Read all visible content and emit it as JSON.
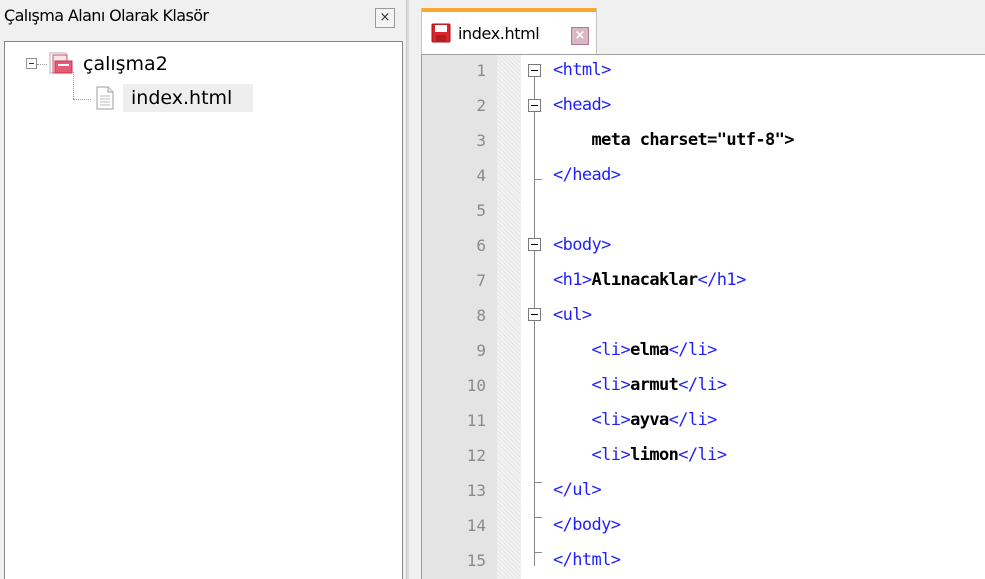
{
  "left_panel": {
    "title": "Çalışma Alanı Olarak Klasör",
    "close_glyph": "×"
  },
  "tree": {
    "root": {
      "label": "çalışma2",
      "icon": "folder-icon",
      "expanded": true
    },
    "children": [
      {
        "label": "index.html",
        "icon": "file-icon"
      }
    ]
  },
  "tabs": [
    {
      "label": "index.html",
      "icon": "save-icon",
      "active": true,
      "close_glyph": "×"
    }
  ],
  "editor": {
    "lines": [
      {
        "num": "1",
        "parts": [
          [
            "tag",
            "<html>"
          ]
        ]
      },
      {
        "num": "2",
        "parts": [
          [
            "tag",
            "<head>"
          ]
        ]
      },
      {
        "num": "3",
        "parts": [
          [
            "txt",
            "    meta charset=\"utf-8\">"
          ]
        ]
      },
      {
        "num": "4",
        "parts": [
          [
            "tag",
            "</head>"
          ]
        ]
      },
      {
        "num": "5",
        "parts": []
      },
      {
        "num": "6",
        "parts": [
          [
            "tag",
            "<body>"
          ]
        ]
      },
      {
        "num": "7",
        "parts": [
          [
            "tag",
            "<h1>"
          ],
          [
            "txt",
            "Alınacaklar"
          ],
          [
            "tag",
            "</h1>"
          ]
        ]
      },
      {
        "num": "8",
        "parts": [
          [
            "tag",
            "<ul>"
          ]
        ]
      },
      {
        "num": "9",
        "parts": [
          [
            "tag",
            "    <li>"
          ],
          [
            "txt",
            "elma"
          ],
          [
            "tag",
            "</li>"
          ]
        ]
      },
      {
        "num": "10",
        "parts": [
          [
            "tag",
            "    <li>"
          ],
          [
            "txt",
            "armut"
          ],
          [
            "tag",
            "</li>"
          ]
        ]
      },
      {
        "num": "11",
        "parts": [
          [
            "tag",
            "    <li>"
          ],
          [
            "txt",
            "ayva"
          ],
          [
            "tag",
            "</li>"
          ]
        ]
      },
      {
        "num": "12",
        "parts": [
          [
            "tag",
            "    <li>"
          ],
          [
            "txt",
            "limon"
          ],
          [
            "tag",
            "</li>"
          ]
        ]
      },
      {
        "num": "13",
        "parts": [
          [
            "tag",
            "</ul>"
          ]
        ]
      },
      {
        "num": "14",
        "parts": [
          [
            "tag",
            "</body>"
          ]
        ]
      },
      {
        "num": "15",
        "parts": [
          [
            "tag",
            "</html>"
          ]
        ]
      }
    ],
    "colors": {
      "tag": "#1f1fff",
      "text": "#000000",
      "line_number": "#8a8a8a",
      "tab_accent": "#f8a731"
    }
  }
}
